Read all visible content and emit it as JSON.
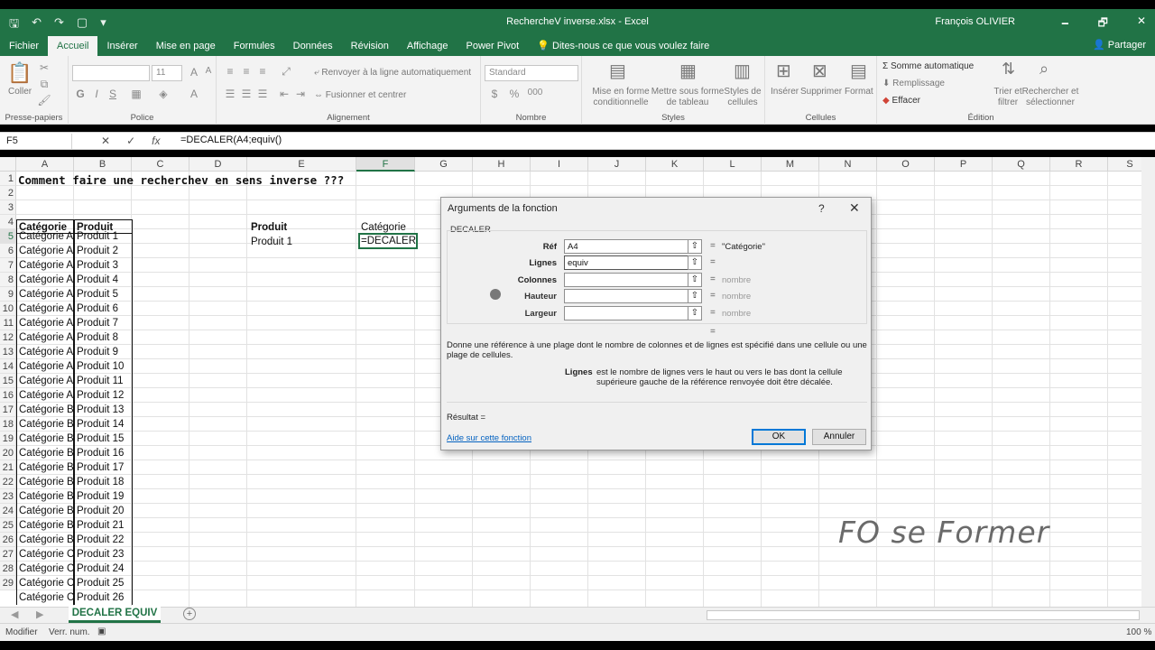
{
  "titlebar": {
    "title": "RechercheV inverse.xlsx  -  Excel",
    "user": "François OLIVIER",
    "minimize": "🗕",
    "restore": "🗗",
    "close": "✕"
  },
  "menu": {
    "tabs": [
      "Fichier",
      "Accueil",
      "Insérer",
      "Mise en page",
      "Formules",
      "Données",
      "Révision",
      "Affichage",
      "Power Pivot"
    ],
    "tellme": "Dites-nous ce que vous voulez faire",
    "share": "Partager"
  },
  "ribbon": {
    "clipboard": {
      "paste": "Coller",
      "label": "Presse-papiers"
    },
    "font": {
      "size": "11",
      "bold": "G",
      "italic": "I",
      "underline": "S",
      "label": "Police"
    },
    "alignment": {
      "wrap": "Renvoyer à la ligne automatiquement",
      "merge": "Fusionner et centrer",
      "label": "Alignement"
    },
    "number": {
      "format": "Standard",
      "currency": "$",
      "percent": "%",
      "thousands": "000",
      "label": "Nombre"
    },
    "styles": {
      "conditional": "Mise en forme conditionnelle",
      "table": "Mettre sous forme de tableau",
      "cellstyles": "Styles de cellules",
      "label": "Styles"
    },
    "cells": {
      "insert": "Insérer",
      "delete": "Supprimer",
      "format": "Format",
      "label": "Cellules"
    },
    "editing": {
      "autosum": "Somme automatique",
      "fill": "Remplissage",
      "clear": "Effacer",
      "sort": "Trier et filtrer",
      "find": "Rechercher et sélectionner",
      "label": "Édition"
    }
  },
  "formulabar": {
    "namebox": "F5",
    "cancel": "✕",
    "enter": "✓",
    "fx": "fx",
    "formula": "=DECALER(A4;equiv()"
  },
  "columns": [
    "A",
    "B",
    "C",
    "D",
    "E",
    "F",
    "G",
    "H",
    "I",
    "J",
    "K",
    "L",
    "M",
    "N",
    "O",
    "P",
    "Q",
    "R",
    "S"
  ],
  "rows": [
    "1",
    "2",
    "3",
    "4",
    "5",
    "6",
    "7",
    "8",
    "9",
    "10",
    "11",
    "12",
    "13",
    "14",
    "15",
    "16",
    "17",
    "18",
    "19",
    "20",
    "21",
    "22",
    "23",
    "24",
    "25",
    "26",
    "27",
    "28",
    "29"
  ],
  "sheet": {
    "title": "Comment faire une recherchev en sens inverse ???",
    "header_categorie": "Catégorie",
    "header_produit": "Produit",
    "data": [
      [
        "Catégorie A",
        "Produit 1"
      ],
      [
        "Catégorie A",
        "Produit 2"
      ],
      [
        "Catégorie A",
        "Produit 3"
      ],
      [
        "Catégorie A",
        "Produit 4"
      ],
      [
        "Catégorie A",
        "Produit 5"
      ],
      [
        "Catégorie A",
        "Produit 6"
      ],
      [
        "Catégorie A",
        "Produit 7"
      ],
      [
        "Catégorie A",
        "Produit 8"
      ],
      [
        "Catégorie A",
        "Produit 9"
      ],
      [
        "Catégorie A",
        "Produit 10"
      ],
      [
        "Catégorie A",
        "Produit 11"
      ],
      [
        "Catégorie A",
        "Produit 12"
      ],
      [
        "Catégorie B",
        "Produit 13"
      ],
      [
        "Catégorie B",
        "Produit 14"
      ],
      [
        "Catégorie B",
        "Produit 15"
      ],
      [
        "Catégorie B",
        "Produit 16"
      ],
      [
        "Catégorie B",
        "Produit 17"
      ],
      [
        "Catégorie B",
        "Produit 18"
      ],
      [
        "Catégorie B",
        "Produit 19"
      ],
      [
        "Catégorie B",
        "Produit 20"
      ],
      [
        "Catégorie B",
        "Produit 21"
      ],
      [
        "Catégorie B",
        "Produit 22"
      ],
      [
        "Catégorie C",
        "Produit 23"
      ],
      [
        "Catégorie C",
        "Produit 24"
      ],
      [
        "Catégorie C",
        "Produit 25"
      ],
      [
        "Catégorie C",
        "Produit 26"
      ]
    ],
    "lookup_header_produit": "Produit",
    "lookup_header_categorie": "Catégorie",
    "lookup_value": "Produit 1",
    "active_cell_content": "=DECALER(A4;equiv("
  },
  "dialog": {
    "title": "Arguments de la fonction",
    "help_icon": "?",
    "close_icon": "✕",
    "function": "DECALER",
    "args": [
      {
        "label": "Réf",
        "value": "A4",
        "result": "\"Catégorie\""
      },
      {
        "label": "Lignes",
        "value": "equiv",
        "result": ""
      },
      {
        "label": "Colonnes",
        "value": "",
        "result": "nombre"
      },
      {
        "label": "Hauteur",
        "value": "",
        "result": "nombre"
      },
      {
        "label": "Largeur",
        "value": "",
        "result": "nombre"
      }
    ],
    "equals": "=",
    "description": "Donne une référence à une plage dont le nombre de colonnes et de lignes est spécifié dans une cellule ou une plage de cellules.",
    "param_name": "Lignes",
    "param_desc": "est le nombre de lignes vers le haut ou vers le bas dont la cellule supérieure gauche de la référence renvoyée doit être décalée.",
    "result_label": "Résultat =",
    "help_link": "Aide sur cette fonction",
    "ok": "OK",
    "cancel": "Annuler"
  },
  "sheettab": {
    "name": "DECALER EQUIV",
    "add": "+"
  },
  "statusbar": {
    "mode": "Modifier",
    "numlock": "Verr. num.",
    "zoom": "100 %"
  },
  "watermark": "FO se Former"
}
